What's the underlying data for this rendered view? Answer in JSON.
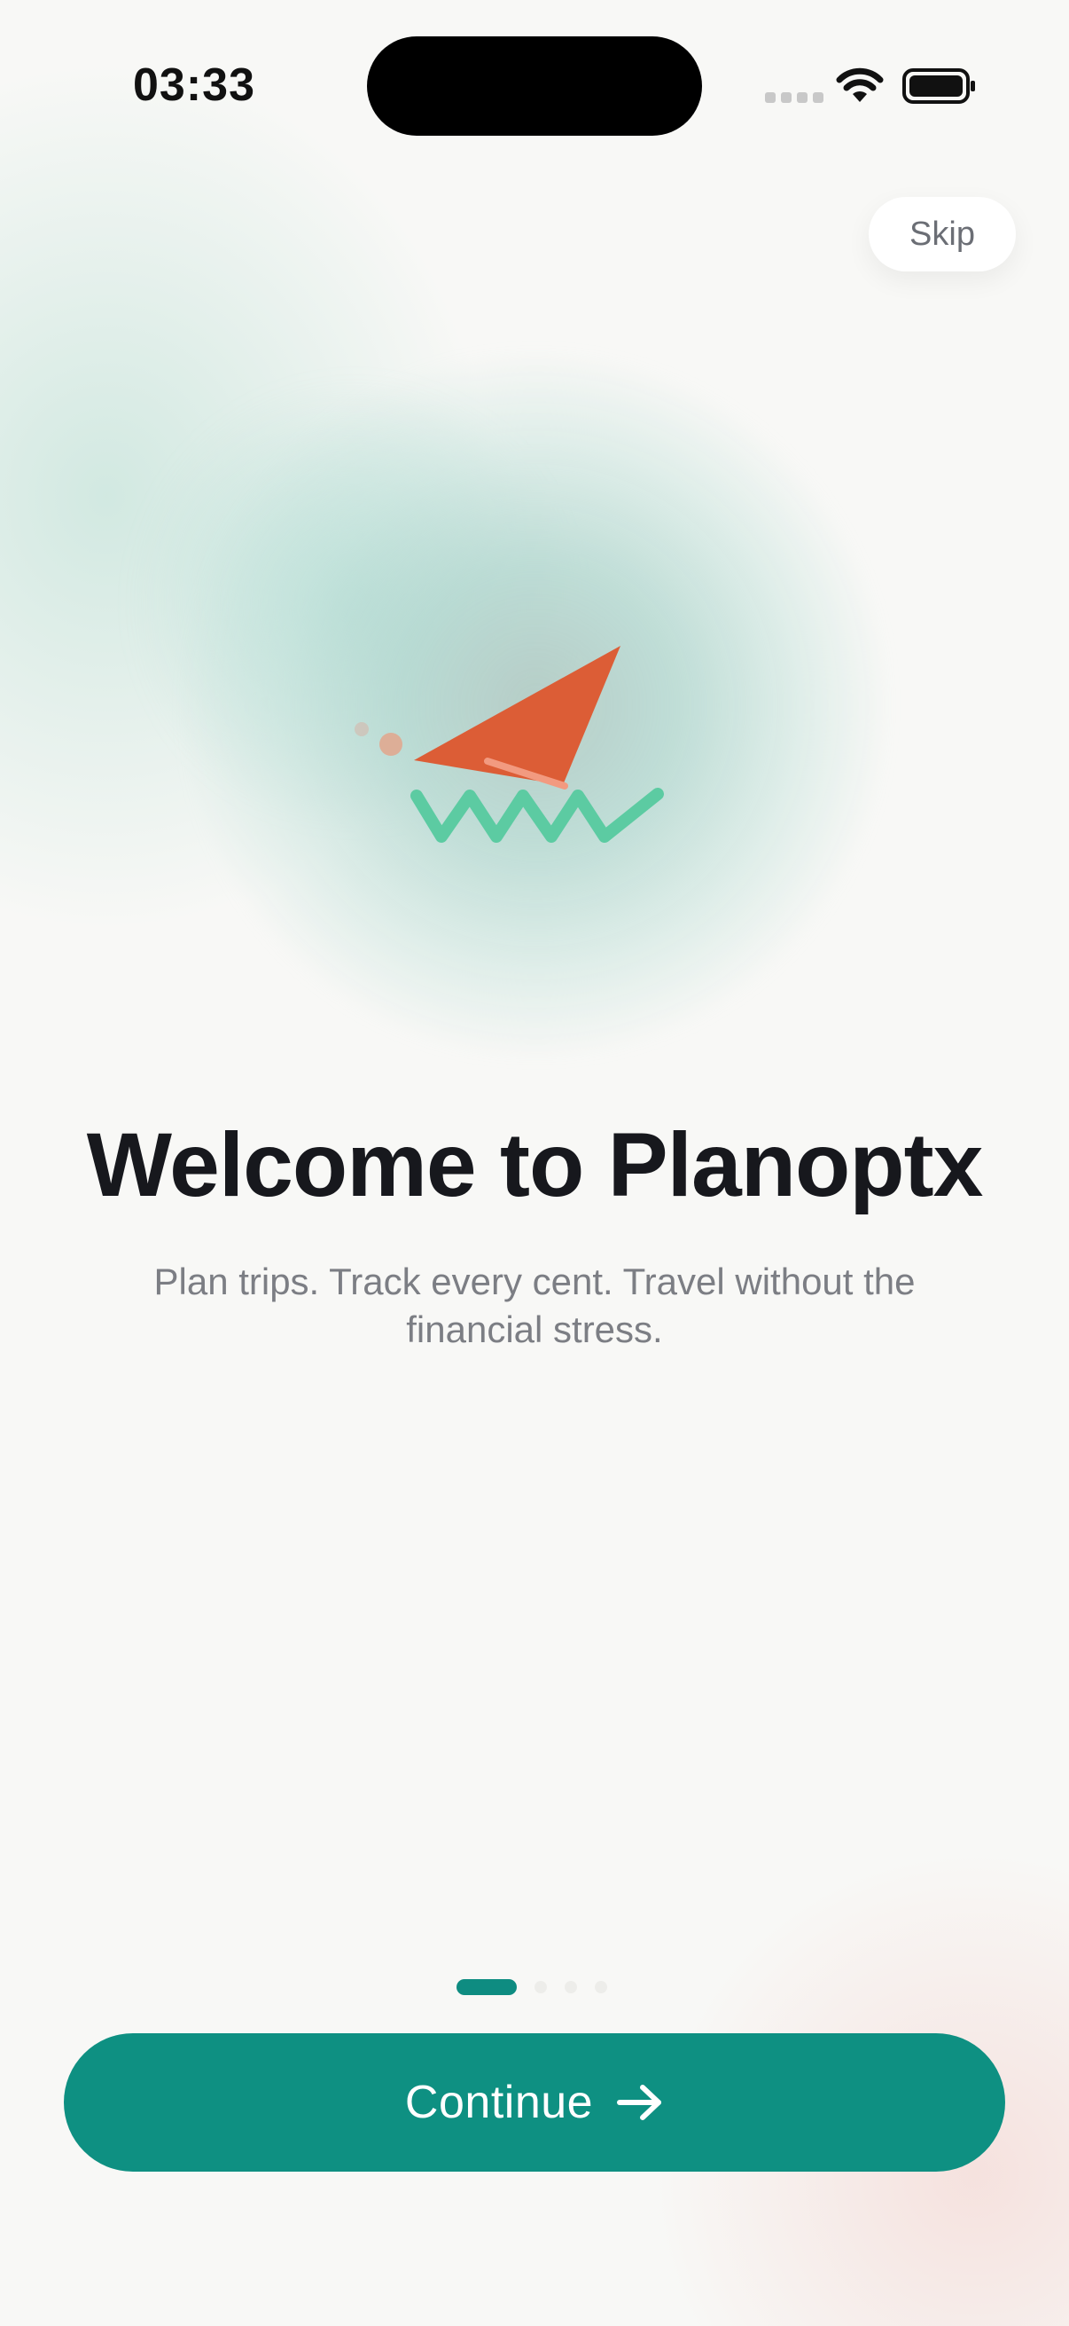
{
  "status_bar": {
    "time": "03:33"
  },
  "header": {
    "skip_label": "Skip"
  },
  "onboarding": {
    "title": "Welcome to Planoptx",
    "subtitle": "Plan trips. Track every cent. Travel without the financial stress.",
    "page_count": 4,
    "current_page": 1
  },
  "footer": {
    "continue_label": "Continue"
  },
  "colors": {
    "primary": "#0e9082",
    "plane": "#dc5d36",
    "waves": "#5ccba2",
    "title": "#17181d",
    "subtitle": "#7c7e84"
  },
  "icons": {
    "illustration": "paper-plane-icon",
    "arrow": "arrow-right-icon"
  }
}
